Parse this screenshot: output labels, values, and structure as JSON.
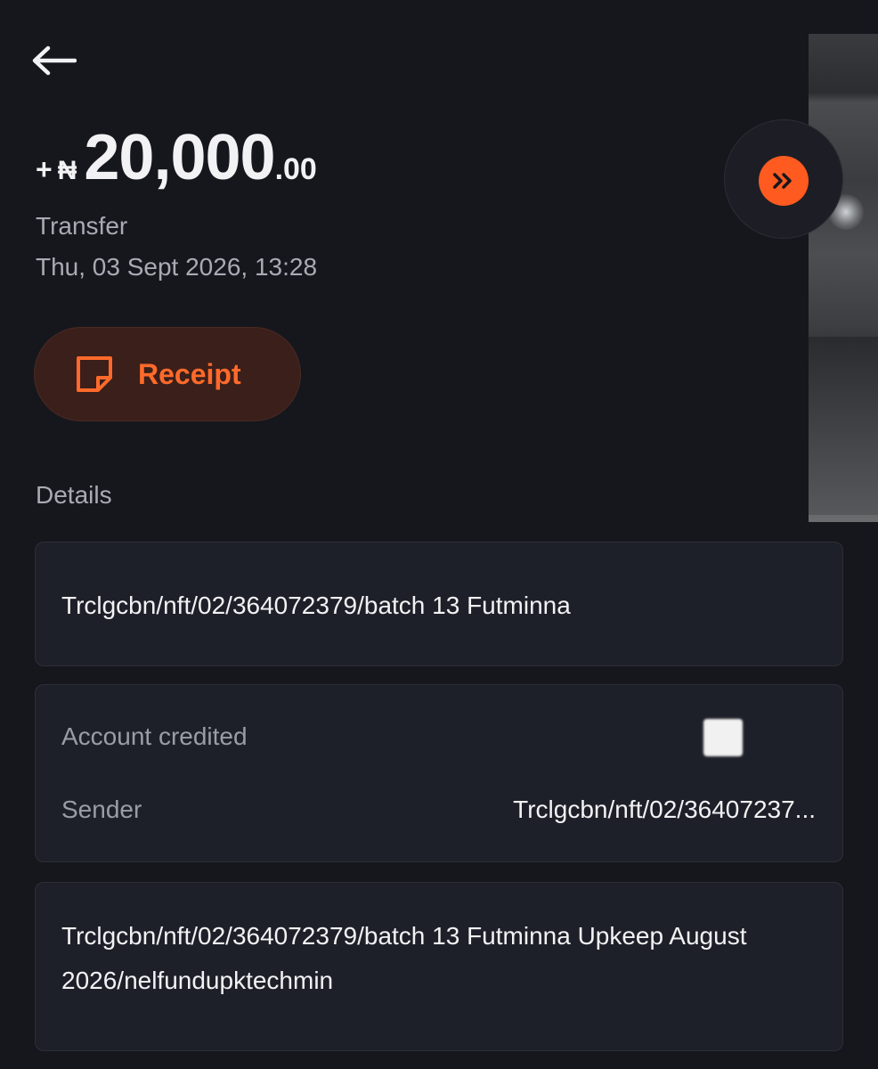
{
  "header": {
    "back_icon": "arrow-left-icon"
  },
  "amount": {
    "sign": "+",
    "currency": "₦",
    "main": "20,000",
    "cents": ".00"
  },
  "transaction": {
    "type": "Transfer",
    "datetime": "Thu, 03 Sept 2026, 13:28"
  },
  "forward_button": {
    "icon": "double-chevron-right-icon",
    "color": "#ff5a1f"
  },
  "receipt_button": {
    "label": "Receipt",
    "icon": "receipt-icon",
    "color": "#ff6a2b"
  },
  "details": {
    "section_label": "Details",
    "reference": "Trclgcbn/nft/02/364072379/batch 13 Futminna",
    "account_credited_label": "Account credited",
    "sender_label": "Sender",
    "sender_value": "Trclgcbn/nft/02/36407237...",
    "narration": "Trclgcbn/nft/02/364072379/batch 13 Futminna Upkeep August 2026/nelfundupktechmin"
  }
}
